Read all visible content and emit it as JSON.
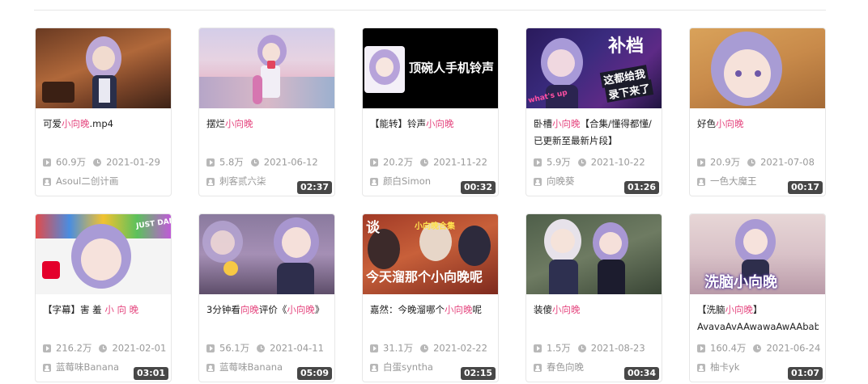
{
  "colors": {
    "highlight": "#e5477f",
    "meta": "#999999",
    "duration_bg": "#000000"
  },
  "icons": {
    "views": "play-icon",
    "date": "clock-icon",
    "author": "user-icon"
  },
  "videos": [
    {
      "title_parts": [
        "可爱",
        "小向晚",
        ".mp4"
      ],
      "duration": "",
      "views": "60.9万",
      "date": "2021-01-29",
      "author": "Asoul二创计画"
    },
    {
      "title_parts": [
        "摆烂",
        "小向晚",
        ""
      ],
      "duration": "02:37",
      "views": "5.8万",
      "date": "2021-06-12",
      "author": "刺客贰六柒"
    },
    {
      "title_parts": [
        "【能转】铃声",
        "小向晚",
        ""
      ],
      "duration": "00:32",
      "thumb_text": "顶碗人手机铃声",
      "views": "20.2万",
      "date": "2021-11-22",
      "author": "颜白Simon"
    },
    {
      "title_parts": [
        "卧槽",
        "小向晚",
        "【合集/懂得都懂/已更新至最新片段】"
      ],
      "duration": "01:26",
      "thumb_text": [
        "补档",
        "这都给我",
        "录下来了",
        "what's up"
      ],
      "views": "5.9万",
      "date": "2021-10-22",
      "author": "向晚葵"
    },
    {
      "title_parts": [
        "好色",
        "小向晚",
        ""
      ],
      "duration": "00:17",
      "views": "20.9万",
      "date": "2021-07-08",
      "author": "一色大魔王"
    },
    {
      "title_parts": [
        "【字幕】害 羞 ",
        "小 向 晚",
        ""
      ],
      "duration": "03:01",
      "thumb_text": "JUST DANCE",
      "views": "216.2万",
      "date": "2021-02-01",
      "author": "蓝莓味Banana"
    },
    {
      "title_parts": [
        "3分钟看",
        "向晚",
        "评价《",
        "小向晚",
        "》"
      ],
      "duration": "05:09",
      "views": "56.1万",
      "date": "2021-04-11",
      "author": "蓝莓味Banana"
    },
    {
      "title_parts": [
        "嘉然：今晚溜哪个",
        "小向晚",
        "呢"
      ],
      "duration": "02:15",
      "thumb_text": [
        "谈",
        "小向晚合集",
        "今天溜那个小向晚呢"
      ],
      "views": "31.1万",
      "date": "2021-02-22",
      "author": "白蛋syntha"
    },
    {
      "title_parts": [
        "装傻",
        "小向晚",
        ""
      ],
      "duration": "00:34",
      "views": "1.5万",
      "date": "2021-08-23",
      "author": "春色向晚"
    },
    {
      "title_parts": [
        "【洗脑",
        "小向晚",
        "】",
        "AvavaAvAAwawaAwAAbab"
      ],
      "duration": "01:07",
      "thumb_text": "洗脑小向晚",
      "views": "160.4万",
      "date": "2021-06-24",
      "author": "柚卡yk"
    }
  ]
}
